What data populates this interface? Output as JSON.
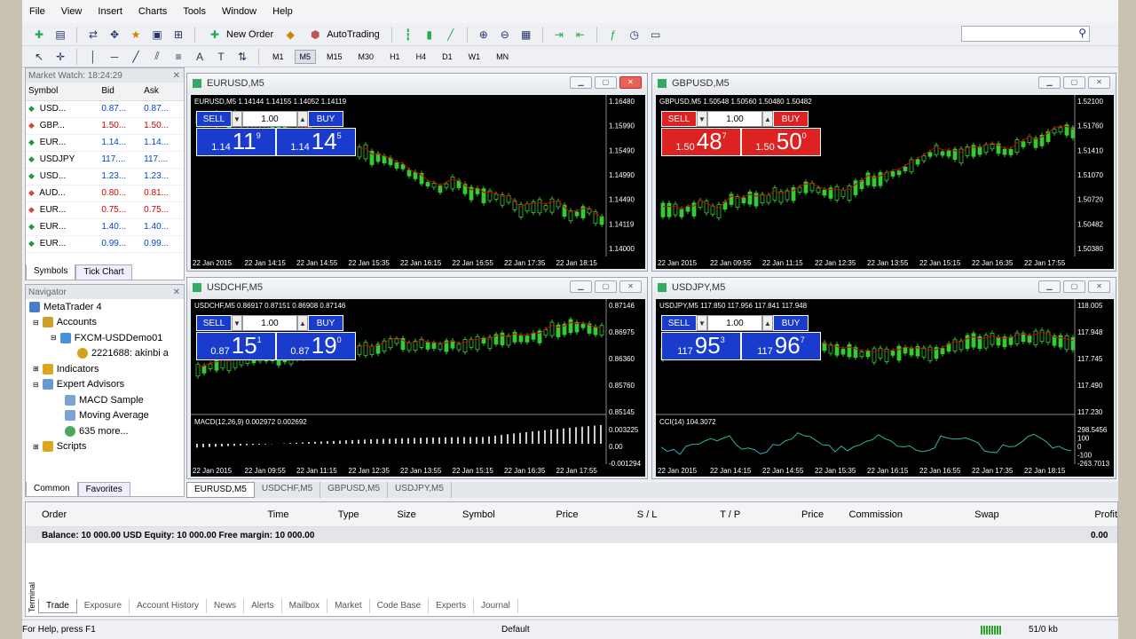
{
  "menu": [
    "File",
    "View",
    "Insert",
    "Charts",
    "Tools",
    "Window",
    "Help"
  ],
  "toolbar": {
    "new_order": "New Order",
    "autotrading": "AutoTrading"
  },
  "timeframes": [
    "M1",
    "M5",
    "M15",
    "M30",
    "H1",
    "H4",
    "D1",
    "W1",
    "MN"
  ],
  "active_timeframe": "M5",
  "market_watch": {
    "title": "Market Watch: 18:24:29",
    "columns": [
      "Symbol",
      "Bid",
      "Ask"
    ],
    "rows": [
      {
        "symbol": "USD...",
        "bid": "0.87...",
        "ask": "0.87...",
        "dir": "up"
      },
      {
        "symbol": "GBP...",
        "bid": "1.50...",
        "ask": "1.50...",
        "dir": "down"
      },
      {
        "symbol": "EUR...",
        "bid": "1.14...",
        "ask": "1.14...",
        "dir": "up"
      },
      {
        "symbol": "USDJPY",
        "bid": "117....",
        "ask": "117....",
        "dir": "up"
      },
      {
        "symbol": "USD...",
        "bid": "1.23...",
        "ask": "1.23...",
        "dir": "up"
      },
      {
        "symbol": "AUD...",
        "bid": "0.80...",
        "ask": "0.81...",
        "dir": "down"
      },
      {
        "symbol": "EUR...",
        "bid": "0.75...",
        "ask": "0.75...",
        "dir": "down"
      },
      {
        "symbol": "EUR...",
        "bid": "1.40...",
        "ask": "1.40...",
        "dir": "up"
      },
      {
        "symbol": "EUR...",
        "bid": "0.99...",
        "ask": "0.99...",
        "dir": "up"
      }
    ],
    "tabs": [
      "Symbols",
      "Tick Chart"
    ]
  },
  "navigator": {
    "title": "Navigator",
    "items": [
      "MetaTrader 4",
      "Accounts",
      "FXCM-USDDemo01",
      "2221688: akinbi a",
      "Indicators",
      "Expert Advisors",
      "MACD Sample",
      "Moving Average",
      "635 more...",
      "Scripts"
    ],
    "tabs": [
      "Common",
      "Favorites"
    ]
  },
  "charts": [
    {
      "title": "EURUSD,M5",
      "info": "EURUSD,M5  1.14144 1.14155 1.14052 1.14119",
      "sell_label": "SELL",
      "buy_label": "BUY",
      "lot": "1.00",
      "sell_small": "1.14",
      "sell_large": "11",
      "sell_pip": "9",
      "buy_small": "1.14",
      "buy_large": "14",
      "buy_pip": "5",
      "color": "#1a3ccc",
      "y_labels": [
        "1.16480",
        "1.15990",
        "1.15490",
        "1.14990",
        "1.14490",
        "1.14119",
        "1.14000"
      ],
      "x_labels": [
        "22 Jan 2015",
        "22 Jan 14:15",
        "22 Jan 14:55",
        "22 Jan 15:35",
        "22 Jan 16:15",
        "22 Jan 16:55",
        "22 Jan 17:35",
        "22 Jan 18:15"
      ],
      "current": "1.14119"
    },
    {
      "title": "GBPUSD,M5",
      "info": "GBPUSD,M5  1.50548 1.50560 1.50480 1.50482",
      "sell_label": "SELL",
      "buy_label": "BUY",
      "lot": "1.00",
      "sell_small": "1.50",
      "sell_large": "48",
      "sell_pip": "7",
      "buy_small": "1.50",
      "buy_large": "50",
      "buy_pip": "0",
      "color": "#d22",
      "y_labels": [
        "1.52100",
        "1.51760",
        "1.51410",
        "1.51070",
        "1.50720",
        "1.50482",
        "1.50380"
      ],
      "x_labels": [
        "22 Jan 2015",
        "22 Jan 09:55",
        "22 Jan 11:15",
        "22 Jan 12:35",
        "22 Jan 13:55",
        "22 Jan 15:15",
        "22 Jan 16:35",
        "22 Jan 17:55"
      ],
      "current": "1.50482"
    },
    {
      "title": "USDCHF,M5",
      "info": "USDCHF,M5  0.86917 0.87151 0.86908 0.87146",
      "sell_label": "SELL",
      "buy_label": "BUY",
      "lot": "1.00",
      "sell_small": "0.87",
      "sell_large": "15",
      "sell_pip": "1",
      "buy_small": "0.87",
      "buy_large": "19",
      "buy_pip": "0",
      "color": "#1a3ccc",
      "y_labels": [
        "0.87146",
        "0.86975",
        "0.86360",
        "0.85760",
        "0.85145"
      ],
      "x_labels": [
        "22 Jan 2015",
        "22 Jan 09:55",
        "22 Jan 11:15",
        "22 Jan 12:35",
        "22 Jan 13:55",
        "22 Jan 15:15",
        "22 Jan 16:35",
        "22 Jan 17:55"
      ],
      "ind_label": "MACD(12,26,9) 0.002972 0.002692",
      "ind_y": [
        "0.003225",
        "0.00",
        "-0.001294"
      ]
    },
    {
      "title": "USDJPY,M5",
      "info": "USDJPY,M5  117.850 117.956 117.841 117.948",
      "sell_label": "SELL",
      "buy_label": "BUY",
      "lot": "1.00",
      "sell_small": "117",
      "sell_large": "95",
      "sell_pip": "3",
      "buy_small": "117",
      "buy_large": "96",
      "buy_pip": "7",
      "color": "#1a3ccc",
      "y_labels": [
        "118.005",
        "117.948",
        "117.745",
        "117.490",
        "117.230"
      ],
      "x_labels": [
        "22 Jan 2015",
        "22 Jan 14:15",
        "22 Jan 14:55",
        "22 Jan 15:35",
        "22 Jan 16:15",
        "22 Jan 16:55",
        "22 Jan 17:35",
        "22 Jan 18:15"
      ],
      "ind_label": "CCI(14) 104.3072",
      "ind_y": [
        "298.5456",
        "100",
        "0",
        "-100",
        "-263.7013"
      ]
    }
  ],
  "chart_tabs": [
    "EURUSD,M5",
    "USDCHF,M5",
    "GBPUSD,M5",
    "USDJPY,M5"
  ],
  "terminal": {
    "columns": [
      "Order",
      "Time",
      "Type",
      "Size",
      "Symbol",
      "Price",
      "S / L",
      "T / P",
      "Price",
      "Commission",
      "Swap",
      "Profit"
    ],
    "balance_row": "Balance: 10 000.00 USD  Equity: 10 000.00  Free margin: 10 000.00",
    "profit": "0.00",
    "tabs": [
      "Trade",
      "Exposure",
      "Account History",
      "News",
      "Alerts",
      "Mailbox",
      "Market",
      "Code Base",
      "Experts",
      "Journal"
    ],
    "label": "Terminal"
  },
  "status": {
    "help": "For Help, press F1",
    "profile": "Default",
    "traffic": "51/0 kb"
  }
}
